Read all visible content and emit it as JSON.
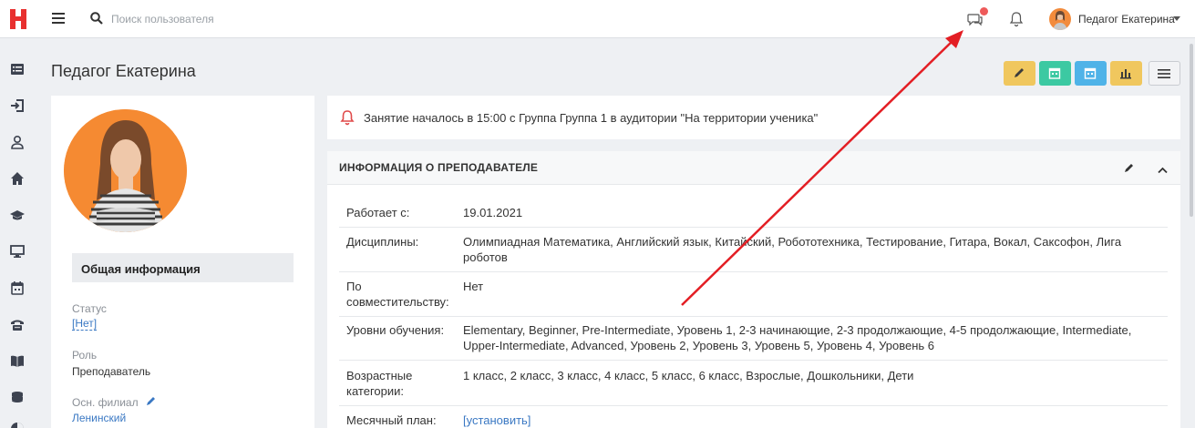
{
  "topbar": {
    "logo_letter": "H",
    "search_placeholder": "Поиск пользователя",
    "user_name": "Педагог Екатерина",
    "icons": [
      "menu-icon",
      "search-icon",
      "chat-icon",
      "bell-icon",
      "caret-down-icon"
    ],
    "notification_color": "#ee5a5a"
  },
  "sidebar": {
    "icons": [
      "list-icon",
      "sign-in-icon",
      "user-icon",
      "home-icon",
      "graduation-cap-icon",
      "monitor-icon",
      "calendar-icon",
      "phone-icon",
      "book-icon",
      "coins-icon",
      "pie-chart-icon"
    ]
  },
  "page": {
    "title": "Педагог Екатерина",
    "actions": [
      {
        "icon": "pencil-icon",
        "color": "#f0c75e"
      },
      {
        "icon": "calendar-icon",
        "color": "#3cc9a2"
      },
      {
        "icon": "calendar-icon",
        "color": "#4fb3e8"
      },
      {
        "icon": "bar-chart-icon",
        "color": "#f0c75e"
      },
      {
        "icon": "menu-icon",
        "color": "#f2f3f5"
      }
    ]
  },
  "profile": {
    "general_tab": "Общая информация",
    "status_label": "Статус",
    "status_value": "[Нет]",
    "role_label": "Роль",
    "role_value": "Преподаватель",
    "branch_label": "Осн. филиал",
    "branch_value": "Ленинский"
  },
  "alert": {
    "text": "Занятие началось в 15:00 с Группа Группа 1 в аудитории \"На территории ученика\""
  },
  "info": {
    "title": "ИНФОРМАЦИЯ О ПРЕПОДАВАТЕЛЕ",
    "rows": [
      {
        "label": "Работает с:",
        "value": "19.01.2021"
      },
      {
        "label": "Дисциплины:",
        "value": "Олимпиадная Математика, Английский язык, Китайский, Робототехника, Тестирование, Гитара, Вокал, Саксофон, Лига роботов"
      },
      {
        "label": "По совместительству:",
        "value": "Нет"
      },
      {
        "label": "Уровни обучения:",
        "value": "Elementary, Beginner, Pre-Intermediate, Уровень 1, 2-3 начинающие, 2-3 продолжающие, 4-5 продолжающие, Intermediate, Upper-Intermediate, Advanced, Уровень 2, Уровень 3, Уровень 5, Уровень 4, Уровень 6"
      },
      {
        "label": "Возрастные категории:",
        "value": "1 класс, 2 класс, 3 класс, 4 класс, 5 класс, 6 класс, Взрослые, Дошкольники, Дети"
      },
      {
        "label": "Месячный план:",
        "value": "[установить]"
      }
    ]
  },
  "colors": {
    "accent": "#3a78c3",
    "arrow": "#e31e24",
    "logo": "#e8302f"
  }
}
